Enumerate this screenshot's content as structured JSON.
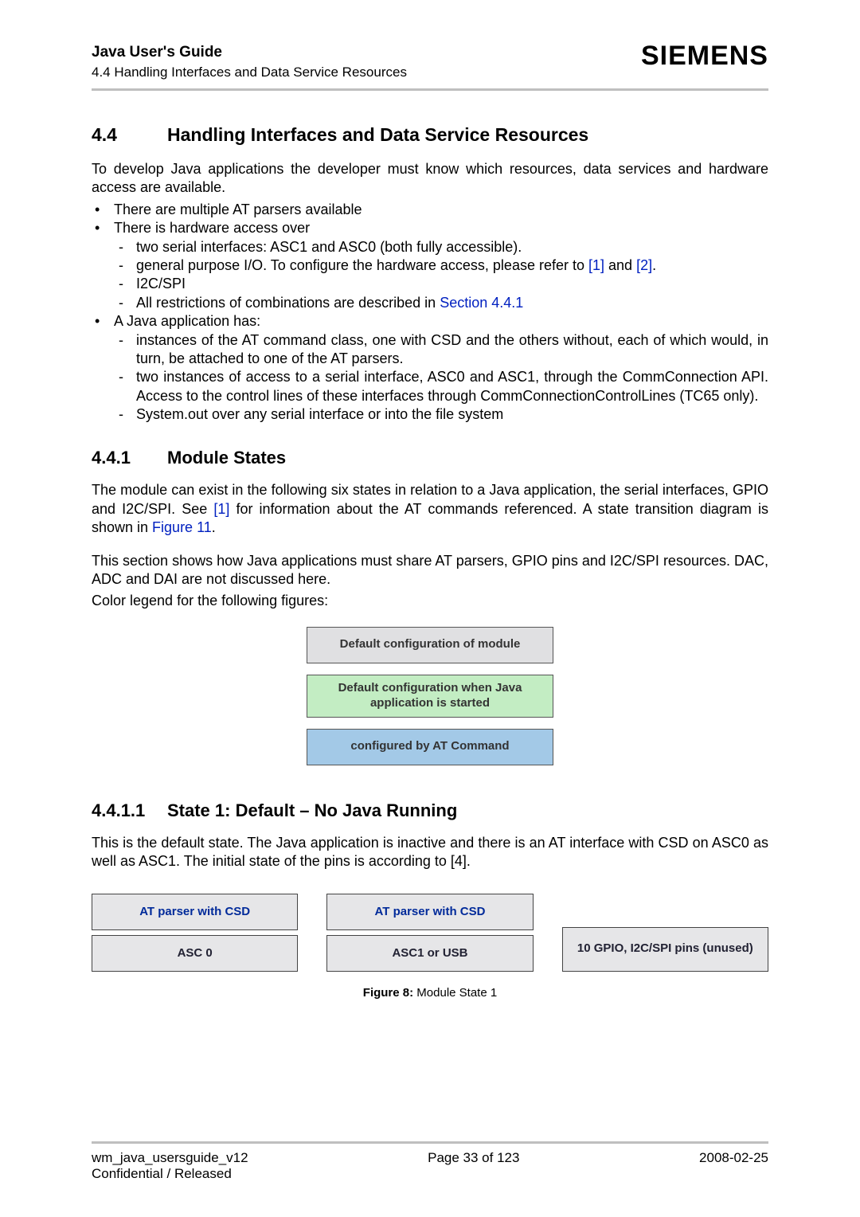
{
  "header": {
    "doc_title": "Java User's Guide",
    "doc_subtitle": "4.4 Handling Interfaces and Data Service Resources",
    "brand": "SIEMENS"
  },
  "section44": {
    "num": "4.4",
    "title": "Handling Interfaces and Data Service Resources",
    "intro": "To develop Java applications the developer must know which resources, data services and hardware access are available.",
    "b1": "There are multiple AT parsers available",
    "b2": "There is hardware access over",
    "b2_1": "two serial interfaces: ASC1 and ASC0 (both fully accessible).",
    "b2_2a": "general purpose I/O. To configure the hardware access, please refer to ",
    "b2_2_ref1": "[1]",
    "b2_2_and": " and ",
    "b2_2_ref2": "[2]",
    "b2_2_end": ".",
    "b2_3": "I2C/SPI",
    "b2_4a": "All restrictions of combinations are described in ",
    "b2_4_link": "Section 4.4.1",
    "b3": "A Java application has:",
    "b3_1": "instances of the AT command class, one with CSD and the others without, each of which would, in turn, be attached to one of the AT parsers.",
    "b3_2": "two instances of access to a serial interface, ASC0 and ASC1, through the CommConnection API. Access to the control lines of these interfaces through CommConnectionControlLines (TC65 only).",
    "b3_3": "System.out over any serial interface or into the file system"
  },
  "section441": {
    "num": "4.4.1",
    "title": "Module States",
    "p1a": "The module can exist in the following six states in relation to a Java application, the serial interfaces, GPIO and I2C/SPI. See ",
    "p1_ref": "[1]",
    "p1b": " for information about the AT commands referenced. A state transition diagram is shown in ",
    "p1_fig": "Figure 11",
    "p1c": ".",
    "p2": "This section shows how Java applications must share AT parsers, GPIO pins and I2C/SPI resources. DAC, ADC and DAI are not discussed here.",
    "p3": "Color legend for the following figures:",
    "legend_gray": "Default configuration of module",
    "legend_green": "Default configuration when Java application is started",
    "legend_blue": "configured by AT Command"
  },
  "section4411": {
    "num": "4.4.1.1",
    "title": "State 1: Default – No Java Running",
    "p1": "This is the default state. The Java application is inactive and there is an AT interface with CSD on ASC0 as well as ASC1. The initial state of the pins is according to [4].",
    "box1a": "AT parser with CSD",
    "box1b": "ASC 0",
    "box2a": "AT parser with CSD",
    "box2b": "ASC1 or USB",
    "box3": "10 GPIO, I2C/SPI  pins (unused)",
    "fig_label": "Figure 8:",
    "fig_text": "  Module State 1"
  },
  "footer": {
    "left1": "wm_java_usersguide_v12",
    "left2": "Confidential / Released",
    "center": "Page 33 of 123",
    "right": "2008-02-25"
  }
}
